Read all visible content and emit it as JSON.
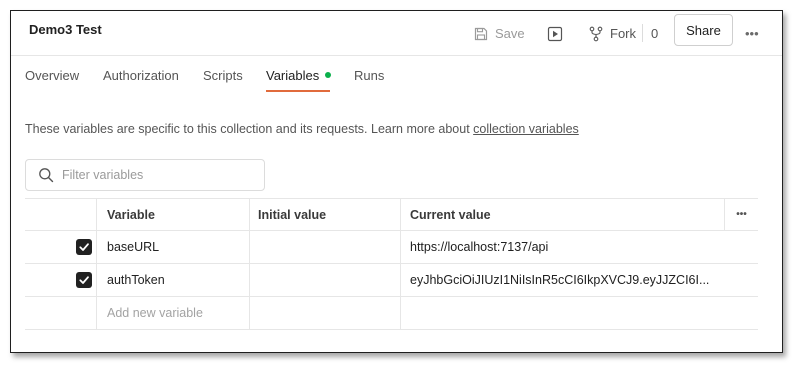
{
  "header": {
    "title": "Demo3 Test",
    "save_label": "Save",
    "fork_label": "Fork",
    "fork_count": "0",
    "share_label": "Share",
    "more_label": "•••"
  },
  "tabs": [
    {
      "label": "Overview",
      "active": false
    },
    {
      "label": "Authorization",
      "active": false
    },
    {
      "label": "Scripts",
      "active": false
    },
    {
      "label": "Variables",
      "active": true
    },
    {
      "label": "Runs",
      "active": false
    }
  ],
  "description": {
    "text": "These variables are specific to this collection and its requests. Learn more about ",
    "link": "collection variables"
  },
  "filter": {
    "placeholder": "Filter variables"
  },
  "table": {
    "columns": {
      "variable": "Variable",
      "initial": "Initial value",
      "current": "Current value",
      "actions": "•••"
    },
    "rows": [
      {
        "checked": true,
        "variable": "baseURL",
        "initial": "",
        "current": "https://localhost:7137/api"
      },
      {
        "checked": true,
        "variable": "authToken",
        "initial": "",
        "current": "eyJhbGciOiJIUzI1NiIsInR5cCI6IkpXVCJ9.eyJJZCI6I..."
      }
    ],
    "add_placeholder": "Add new variable"
  },
  "colors": {
    "accent": "#e16b3c",
    "active_dot": "#0bb04b",
    "checkbox": "#212121"
  }
}
